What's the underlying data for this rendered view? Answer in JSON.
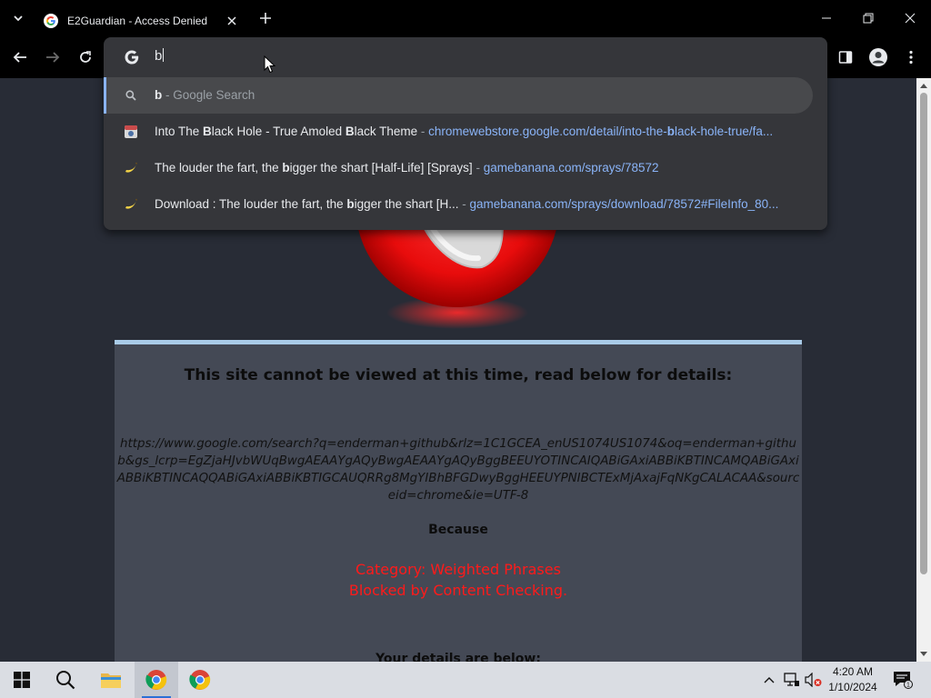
{
  "browser": {
    "tab_title": "E2Guardian - Access Denied",
    "omnibox_value": "b",
    "suggestions": [
      {
        "icon": "magnifier-icon",
        "main_bold": "b",
        "main_rest": " - Google Search",
        "url": ""
      },
      {
        "icon": "extension-favicon",
        "main_pre": "Into The ",
        "main_b1": "B",
        "main_mid": "lack Hole - True Amoled ",
        "main_b2": "B",
        "main_post": "lack Theme",
        "separator": " - ",
        "url_pre": "chromewebstore.google.com/detail/into-the-",
        "url_bold": "b",
        "url_post": "lack-hole-true/fa..."
      },
      {
        "icon": "banana-icon",
        "main_pre": "The louder the fart, the ",
        "main_b1": "b",
        "main_post": "igger the shart [Half-Life] [Sprays]",
        "separator": " - ",
        "url": "gamebanana.com/sprays/78572"
      },
      {
        "icon": "banana-icon",
        "main_pre": "Download : The louder the fart, the ",
        "main_b1": "b",
        "main_post": "igger the shart [H...",
        "separator": " - ",
        "url": "gamebanana.com/sprays/download/78572#FileInfo_80..."
      }
    ]
  },
  "page": {
    "heading": "This site cannot be viewed at this time, read below for details:",
    "blocked_url": "https://www.google.com/search?q=enderman+github&rlz=1C1GCEA_enUS1074US1074&oq=enderman+github&gs_lcrp=EgZjaHJvbWUqBwgAEAAYgAQyBwgAEAAYgAQyBggBEEUYOTINCAIQABiGAxiABBiKBTINCAMQABiGAxiABBiKBTINCAQQABiGAxiABBiKBTIGCAUQRRg8MgYIBhBFGDwyBggHEEUYPNIBCTExMjAxajFqNKgCALACAA&sourceid=chrome&ie=UTF-8",
    "because": "Because",
    "reason_line1": "Category: Weighted Phrases",
    "reason_line2": "Blocked by Content Checking.",
    "details_heading": "Your details are below:"
  },
  "taskbar": {
    "time": "4:20 AM",
    "date": "1/10/2024",
    "notification_count": "1"
  },
  "colors": {
    "accent": "#8ab4f8",
    "reason_red": "#ff1a1a",
    "panel_bg": "#444955",
    "page_bg": "#282c36"
  }
}
